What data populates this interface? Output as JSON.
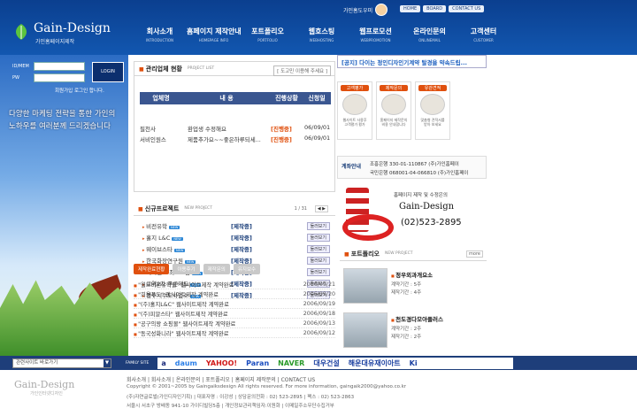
{
  "header": {
    "logo_name": "Gain-Design",
    "logo_sub": "가인홈페이지제작",
    "mascot_text": "가인홈도우미",
    "top_links": [
      "HOME",
      "BOARD",
      "CONTACT US"
    ],
    "nav": [
      {
        "ko": "회사소개",
        "en": "INTRODUCTION"
      },
      {
        "ko": "홈페이지 제작안내",
        "en": "HOMEPAGE INFO"
      },
      {
        "ko": "포트폴리오",
        "en": "PORTFOLIO"
      },
      {
        "ko": "웹호스팅",
        "en": "WEBHOSTING"
      },
      {
        "ko": "웹프로모션",
        "en": "WEBPROMOTION"
      },
      {
        "ko": "온라인문의",
        "en": "ONLINEMAIL"
      },
      {
        "ko": "고객센터",
        "en": "CUSTOMER"
      }
    ]
  },
  "login": {
    "id_label": "ID/MEM",
    "pw_label": "PW",
    "button": "LOGIN",
    "join": "회원가입 로그인 합니다."
  },
  "slogan": [
    "다양한 마케팅 전략을 통한 가인의",
    "노하우를 여러분께 드리겠습니다"
  ],
  "project": {
    "title": "관리업체 현황",
    "title_en": "PROJECT LIST",
    "search": "[ 도고민 이용해 주세요 ]",
    "headers": [
      "업체명",
      "내 용",
      "진행상황",
      "신청일"
    ],
    "rows": [
      {
        "name": "필천사",
        "content": "환업생 수정해요",
        "status": "[진행중]",
        "date": "06/09/01"
      },
      {
        "name": "서비인원스",
        "content": "제품추가요~~좋은하루되세...",
        "status": "[진행중]",
        "date": "06/09/01"
      }
    ]
  },
  "newproj": {
    "title": "신규프로젝트",
    "title_en": "NEW PROJECT",
    "page": "1 / 31",
    "items": [
      {
        "name": "비전유학",
        "status": "[제작중]",
        "btn": "둘러보기"
      },
      {
        "name": "홀지 L&C",
        "status": "[제작중]",
        "btn": "둘러보기"
      },
      {
        "name": "웨이브스타",
        "status": "[제작중]",
        "btn": "둘러보기"
      },
      {
        "name": "한국화장연구원",
        "status": "[제작중]",
        "btn": "둘러보기"
      },
      {
        "name": "지니텐트 최고포함",
        "status": "[제작중]",
        "btn": "둘러보기"
      },
      {
        "name": "교역2차 푸른제도",
        "status": "[제작중]",
        "btn": "둘러보기"
      },
      {
        "name": "경주시수도사업소",
        "status": "[제작중]",
        "btn": "둘러보기"
      }
    ]
  },
  "tabs": [
    "제작완료현황",
    "이용후기",
    "제작문의",
    "유지보수"
  ],
  "contracts": [
    {
      "text": "\"월드비전유학원\" 웹사이트제작 계약완료",
      "date": "2006/09/21"
    },
    {
      "text": "\"희용푸드\" 웹사이트제작 계약완료",
      "date": "2006/09/20"
    },
    {
      "text": "\"(주)홀지L&C\" 웹사이트제작 계약완료",
      "date": "2006/09/19"
    },
    {
      "text": "\"(주)피알스타\" 웹사이트제작 계약완료",
      "date": "2006/09/18"
    },
    {
      "text": "\"공구의왕 쇼핑몰\" 웹사이트제작 계약완료",
      "date": "2006/09/13"
    },
    {
      "text": "\"동국성화니라\" 웹사이트제작 계약완료",
      "date": "2006/09/12"
    }
  ],
  "notice": "[공지] 다이는 정인디자인기계약 탈경을 약속드립...",
  "cards": [
    {
      "title": "고객평가",
      "desc": [
        "웹사이트 사용후",
        "고객평가 평가"
      ]
    },
    {
      "title": "제작문의",
      "desc": [
        "홈페이지 제작문의",
        "비용 안내합니다"
      ]
    },
    {
      "title": "유관견적",
      "desc": [
        "맞춤형 견적서를",
        "받아 보세요"
      ]
    }
  ],
  "account": {
    "title": "계좌안내",
    "lines": [
      "조흥은행 330-01-110867 (주)가인홈페이",
      "국민은행 068001-04-066810 (주)가인홈페이"
    ]
  },
  "banner": {
    "line1": "홈페이지 제작 및 수정은의",
    "line2": "Gain-Design",
    "line3": "(02)523-2895"
  },
  "portfolio": {
    "title": "포트폴리오",
    "title_en": "NEW PROJECT",
    "more": "more",
    "items": [
      {
        "name": "정우외과개요소",
        "desc": [
          "계약기간 : 5주",
          "제작기간 : 4주"
        ]
      },
      {
        "name": "천도경다모아플러스",
        "desc": [
          "계약기간 : 2주",
          "제작기간 : 2주"
        ]
      }
    ]
  },
  "family": {
    "select": "관련사이트 바로가기",
    "label": "FAMILY SITE",
    "partners": [
      {
        "name": "a",
        "color": "#1a2a7a"
      },
      {
        "name": "daum",
        "color": "#2a7ee8"
      },
      {
        "name": "YAHOO!",
        "color": "#d01818"
      },
      {
        "name": "Paran",
        "color": "#1a4cbf"
      },
      {
        "name": "NAVER",
        "color": "#2a9a2a"
      },
      {
        "name": "대우건설",
        "color": "#1a3fa0"
      },
      {
        "name": "해운대유재이아트",
        "color": "#1a3fa0"
      },
      {
        "name": "Ki",
        "color": "#1a3fa0"
      }
    ]
  },
  "footer": {
    "logo": "Gain-Design",
    "logo_sub": "가인인터넷디자인",
    "links": "회사소개 | 회사소개 | 온라인문의 | 포트폴리오 | 홈페이지 제작문의 | CONTACT US",
    "lines": [
      "Copyright © 2001~2005 by Gaingaiksdesign All rights reserved. For more information, gaingaik2000@yahoo.co.kr",
      "(주)자연글로벌(가인디자인기획) | 대표자명 : 이강성 | 상담문의전화 : 02) 523-2895 | 팩스 : 02) 523-2863",
      "서울시 서초구 방배동 941-10 가이디빌딩5층 | 개인정보관리책임자:이원화 | 이메일주소무단수집거부"
    ]
  },
  "colors": {
    "header": "#0b3f8f",
    "accent": "#e0500e",
    "table_head": "#3a5690"
  }
}
